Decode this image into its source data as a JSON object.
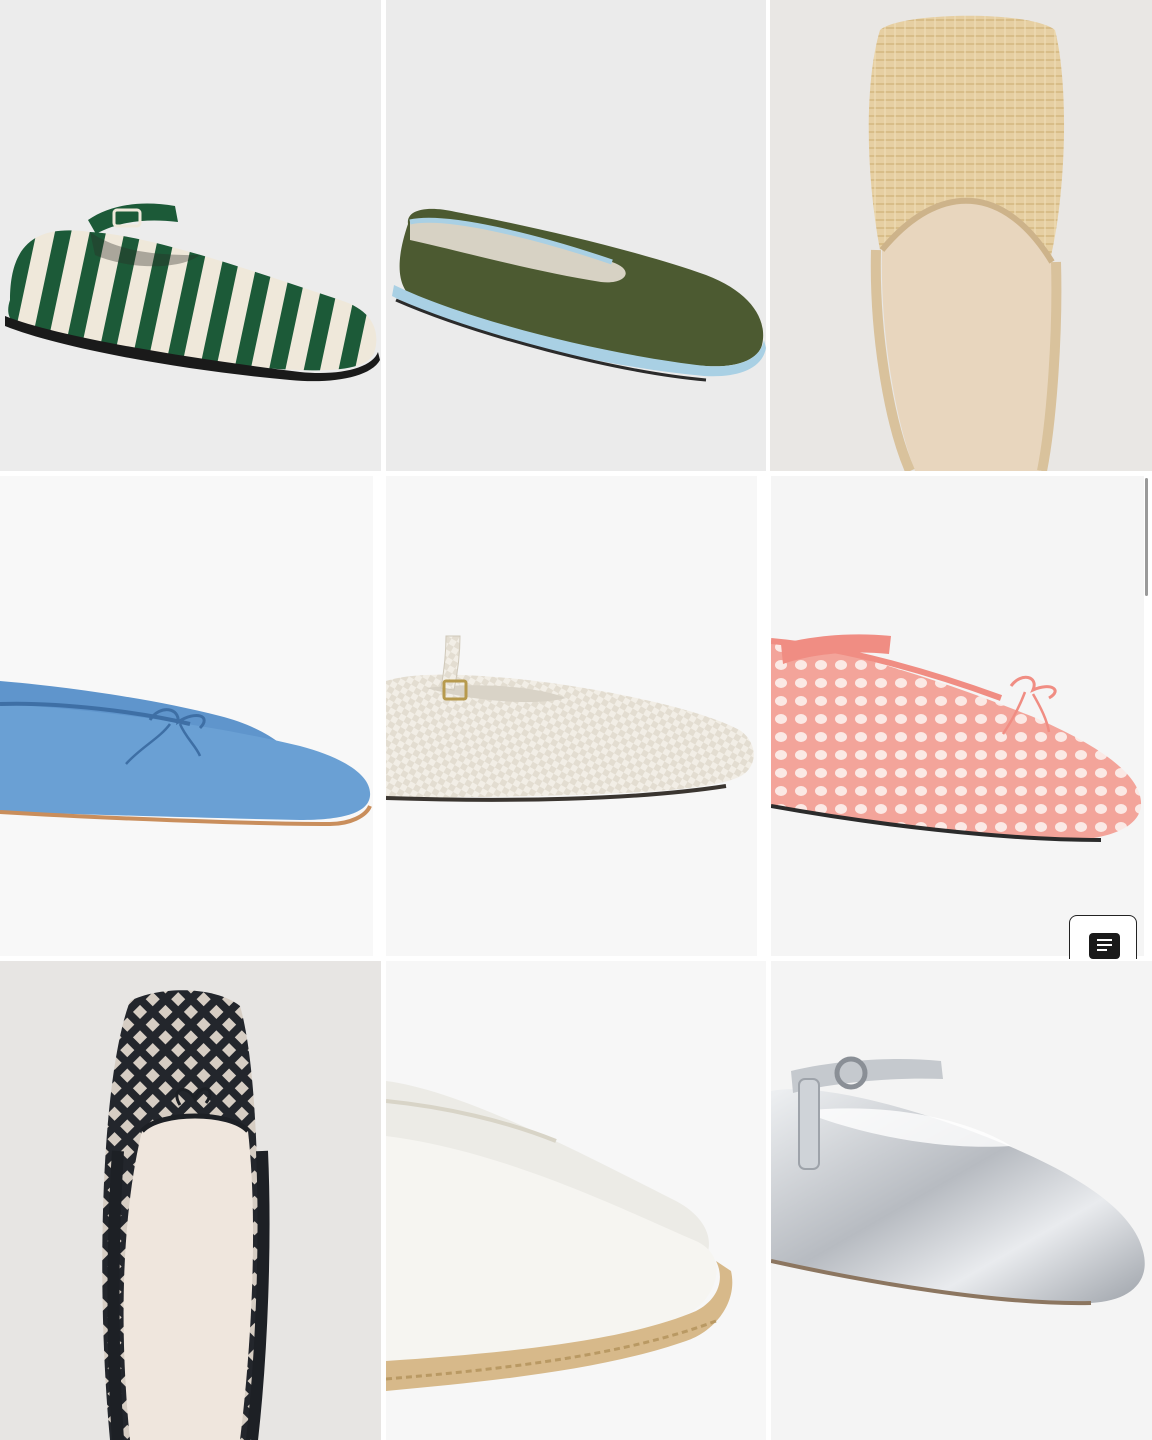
{
  "products": [
    {
      "name": "green-stripe-mary-jane-flat",
      "accent": "#1f5a3a"
    },
    {
      "name": "olive-velvet-slipper-flat",
      "accent": "#4b5a30"
    },
    {
      "name": "raffia-mule-flat",
      "accent": "#e3c99a"
    },
    {
      "name": "blue-leather-ballet-flat",
      "accent": "#5b8fc9"
    },
    {
      "name": "cream-woven-mary-jane-flat",
      "accent": "#f1ede4"
    },
    {
      "name": "pink-mesh-ballet-flat",
      "accent": "#f2a39a"
    },
    {
      "name": "black-woven-ballet-flat",
      "accent": "#25282d"
    },
    {
      "name": "white-canvas-espadrille",
      "accent": "#f4f2ec"
    },
    {
      "name": "silver-metallic-mary-jane-flat",
      "accent": "#c9cbcf"
    }
  ],
  "floating_button": {
    "icon": "list-menu-icon"
  },
  "scrollbar": {
    "visible": true
  }
}
